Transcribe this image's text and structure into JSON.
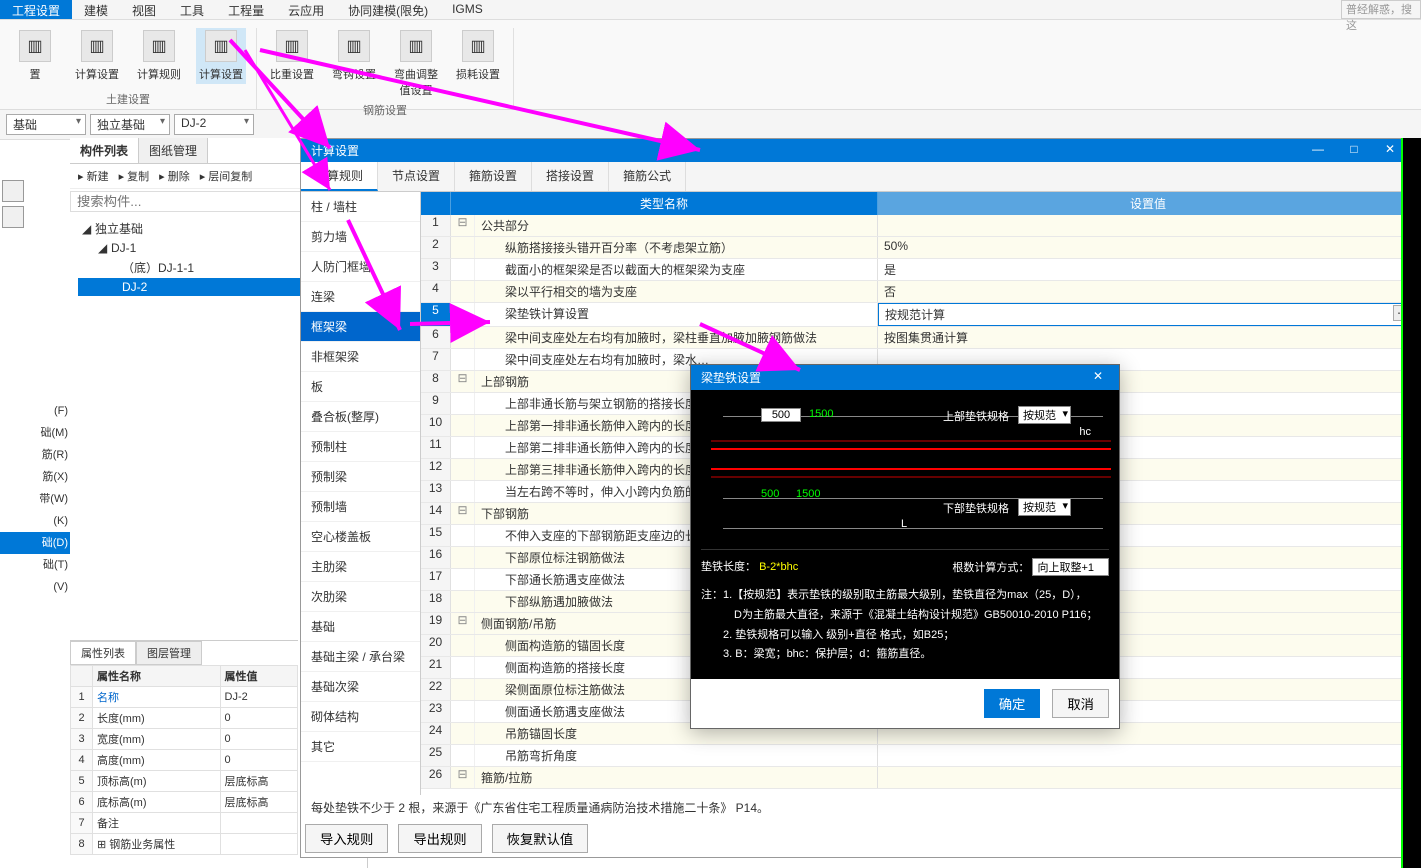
{
  "menubar": {
    "items": [
      "工程设置",
      "建模",
      "视图",
      "工具",
      "工程量",
      "云应用",
      "协同建模(限免)",
      "IGMS"
    ],
    "search_placeholder": "普经解惑，搜这"
  },
  "ribbon": {
    "group1": {
      "label": "土建设置",
      "buttons": [
        "置",
        "计算设置",
        "计算规则",
        "计算设置"
      ]
    },
    "group2": {
      "label": "钢筋设置",
      "buttons": [
        "比重设置",
        "弯钩设置",
        "弯曲调整值设置",
        "损耗设置"
      ]
    }
  },
  "combos": [
    "基础",
    "独立基础",
    "DJ-2"
  ],
  "leftPanel": {
    "tabs": [
      "构件列表",
      "图纸管理"
    ],
    "tools": [
      "新建",
      "复制",
      "删除",
      "层间复制"
    ],
    "search_placeholder": "搜索构件...",
    "tree": [
      {
        "label": "独立基础",
        "lvl": 1,
        "exp": true
      },
      {
        "label": "DJ-1",
        "lvl": 2,
        "exp": true
      },
      {
        "label": "（底）DJ-1-1",
        "lvl": 3
      },
      {
        "label": "DJ-2",
        "lvl": 4,
        "sel": true
      }
    ]
  },
  "leftTrunc": [
    "(F)",
    "础(M)",
    "筋(R)",
    "筋(X)",
    "带(W)",
    "(K)",
    "",
    "础(D)",
    "础(T)",
    "(V)"
  ],
  "leftTruncSel": 7,
  "propPanel": {
    "tabs": [
      "属性列表",
      "图层管理"
    ],
    "headers": [
      "",
      "属性名称",
      "属性值"
    ],
    "rows": [
      {
        "n": "1",
        "name": "名称",
        "val": "DJ-2",
        "blue": true
      },
      {
        "n": "2",
        "name": "长度(mm)",
        "val": "0"
      },
      {
        "n": "3",
        "name": "宽度(mm)",
        "val": "0"
      },
      {
        "n": "4",
        "name": "高度(mm)",
        "val": "0"
      },
      {
        "n": "5",
        "name": "顶标高(m)",
        "val": "层底标高"
      },
      {
        "n": "6",
        "name": "底标高(m)",
        "val": "层底标高"
      },
      {
        "n": "7",
        "name": "备注",
        "val": ""
      },
      {
        "n": "8",
        "name": "钢筋业务属性",
        "val": "",
        "plus": true
      }
    ]
  },
  "mainDialog": {
    "title": "计算设置",
    "tabs": [
      "计算规则",
      "节点设置",
      "箍筋设置",
      "搭接设置",
      "箍筋公式"
    ],
    "headers": {
      "type": "类型名称",
      "val": "设置值"
    },
    "cats": [
      "柱 / 墙柱",
      "剪力墙",
      "人防门框墙",
      "连梁",
      "框架梁",
      "非框架梁",
      "板",
      "叠合板(整厚)",
      "预制柱",
      "预制梁",
      "预制墙",
      "空心楼盖板",
      "主肋梁",
      "次肋梁",
      "基础",
      "基础主梁 / 承台梁",
      "基础次梁",
      "砌体结构",
      "其它"
    ],
    "catSel": 4,
    "rows": [
      {
        "n": "1",
        "group": true,
        "name": "公共部分"
      },
      {
        "n": "2",
        "name": "纵筋搭接接头错开百分率（不考虑架立筋）",
        "val": "50%"
      },
      {
        "n": "3",
        "name": "截面小的框架梁是否以截面大的框架梁为支座",
        "val": "是"
      },
      {
        "n": "4",
        "name": "梁以平行相交的墙为支座",
        "val": "否"
      },
      {
        "n": "5",
        "name": "梁垫铁计算设置",
        "val": "按规范计算",
        "sel": true
      },
      {
        "n": "6",
        "name": "梁中间支座处左右均有加腋时，梁柱垂直加腋加腋钢筋做法",
        "val": "按图集贯通计算"
      },
      {
        "n": "7",
        "name": "梁中间支座处左右均有加腋时，梁水…",
        "val": ""
      },
      {
        "n": "8",
        "group": true,
        "name": "上部钢筋"
      },
      {
        "n": "9",
        "name": "上部非通长筋与架立钢筋的搭接长度",
        "val": ""
      },
      {
        "n": "10",
        "name": "上部第一排非通长筋伸入跨内的长度",
        "val": ""
      },
      {
        "n": "11",
        "name": "上部第二排非通长筋伸入跨内的长度",
        "val": ""
      },
      {
        "n": "12",
        "name": "上部第三排非通长筋伸入跨内的长度",
        "val": ""
      },
      {
        "n": "13",
        "name": "当左右跨不等时，伸入小跨内负筋的…",
        "val": ""
      },
      {
        "n": "14",
        "group": true,
        "name": "下部钢筋"
      },
      {
        "n": "15",
        "name": "不伸入支座的下部钢筋距支座边的长…",
        "val": ""
      },
      {
        "n": "16",
        "name": "下部原位标注钢筋做法",
        "val": ""
      },
      {
        "n": "17",
        "name": "下部通长筋遇支座做法",
        "val": ""
      },
      {
        "n": "18",
        "name": "下部纵筋遇加腋做法",
        "val": ""
      },
      {
        "n": "19",
        "group": true,
        "name": "侧面钢筋/吊筋"
      },
      {
        "n": "20",
        "name": "侧面构造筋的锚固长度",
        "val": ""
      },
      {
        "n": "21",
        "name": "侧面构造筋的搭接长度",
        "val": ""
      },
      {
        "n": "22",
        "name": "梁侧面原位标注筋做法",
        "val": ""
      },
      {
        "n": "23",
        "name": "侧面通长筋遇支座做法",
        "val": ""
      },
      {
        "n": "24",
        "name": "吊筋锚固长度",
        "val": ""
      },
      {
        "n": "25",
        "name": "吊筋弯折角度",
        "val": ""
      },
      {
        "n": "26",
        "group": true,
        "name": "箍筋/拉筋"
      }
    ],
    "note": "每处垫铁不少于 2 根，来源于《广东省住宅工程质量通病防治技术措施二十条》 P14。",
    "footerBtns": [
      "导入规则",
      "导出规则",
      "恢复默认值"
    ]
  },
  "subDialog": {
    "title": "梁垫铁设置",
    "top_spec_label": "上部垫铁规格",
    "bot_spec_label": "下部垫铁规格",
    "spec_val": "按规范",
    "input1": "500",
    "dim1": "1500",
    "input2": "500",
    "dim2": "1500",
    "hc": "hc",
    "L": "L",
    "formula_label": "垫铁长度：",
    "formula": "B-2*bhc",
    "calc_label": "根数计算方式：",
    "calc_val": "向上取整+1",
    "notes": [
      "注：1.【按规范】表示垫铁的级别取主筋最大级别，垫铁直径为max（25，D），",
      "　　　D为主筋最大直径，来源于《混凝土结构设计规范》GB50010-2010 P116；",
      "　　2. 垫铁规格可以输入 级别+直径 格式，如B25；",
      "　　3. B：梁宽；bhc：保护层；d：箍筋直径。"
    ],
    "ok": "确定",
    "cancel": "取消"
  }
}
